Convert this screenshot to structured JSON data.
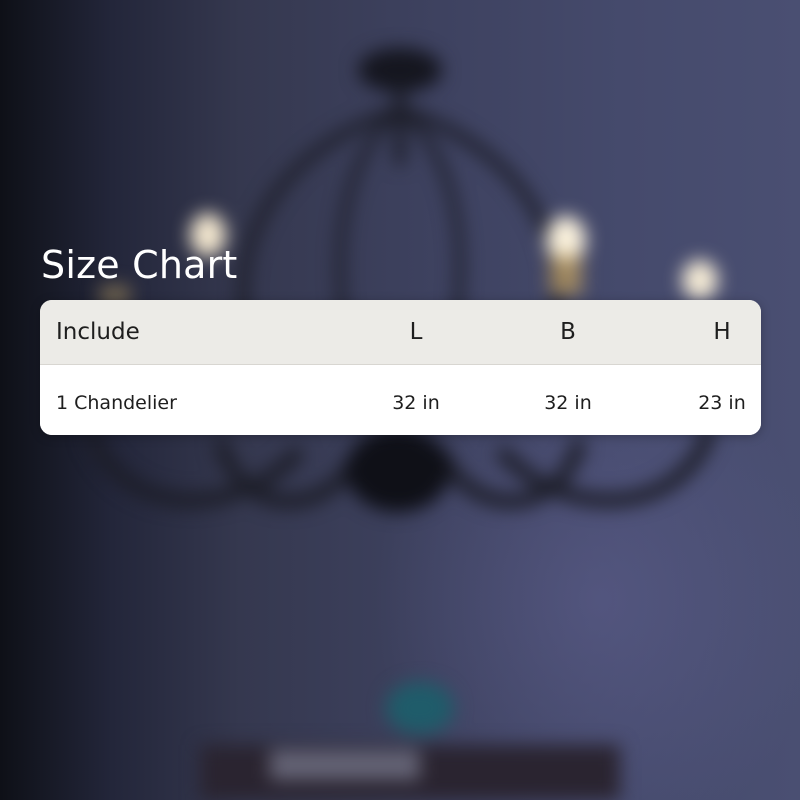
{
  "title": "Size Chart",
  "table": {
    "headers": [
      "Include",
      "L",
      "B",
      "H"
    ],
    "rows": [
      [
        "1 Chandelier",
        "32 in",
        "32 in",
        "23 in"
      ]
    ]
  },
  "colors": {
    "background": "#3e4260",
    "header_row": "#ecebe7",
    "body_row": "#ffffff",
    "title_text": "#ffffff",
    "table_text": "#1e1e1e"
  }
}
